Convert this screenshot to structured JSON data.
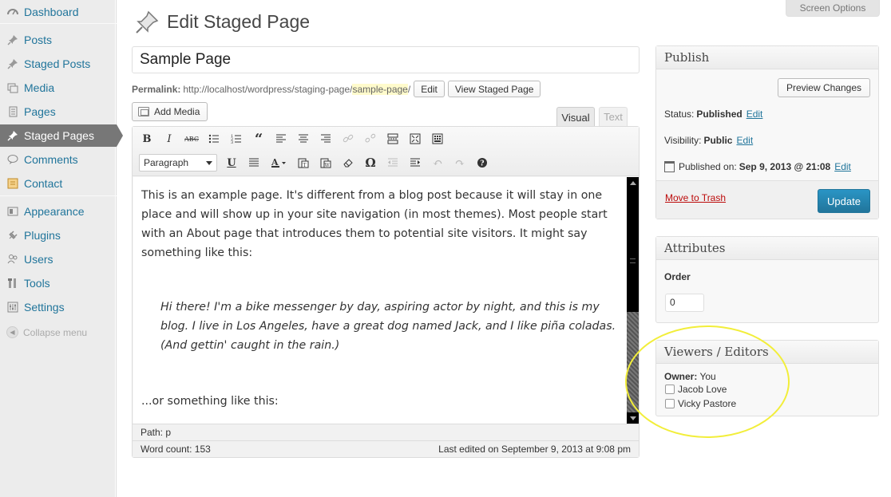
{
  "admin_menu": {
    "items": [
      {
        "label": "Dashboard",
        "icon": "dashboard-icon"
      },
      {
        "label": "Posts",
        "icon": "pin-icon"
      },
      {
        "label": "Staged Posts",
        "icon": "pin-icon"
      },
      {
        "label": "Media",
        "icon": "media-icon"
      },
      {
        "label": "Pages",
        "icon": "pages-icon"
      },
      {
        "label": "Staged Pages",
        "icon": "pin-icon",
        "current": true
      },
      {
        "label": "Comments",
        "icon": "comment-icon"
      },
      {
        "label": "Contact",
        "icon": "contact-icon"
      },
      {
        "label": "Appearance",
        "icon": "appearance-icon"
      },
      {
        "label": "Plugins",
        "icon": "plugin-icon"
      },
      {
        "label": "Users",
        "icon": "users-icon"
      },
      {
        "label": "Tools",
        "icon": "tools-icon"
      },
      {
        "label": "Settings",
        "icon": "settings-icon"
      }
    ],
    "collapse_label": "Collapse menu"
  },
  "header": {
    "title": "Edit Staged Page",
    "screen_options": "Screen Options"
  },
  "post": {
    "title": "Sample Page",
    "permalink_label": "Permalink:",
    "permalink_base": "http://localhost/wordpress/staging-page/",
    "permalink_slug": "sample-page",
    "permalink_end": "/",
    "edit_button": "Edit",
    "view_button": "View Staged Page"
  },
  "editor": {
    "add_media": "Add Media",
    "tab_visual": "Visual",
    "tab_text": "Text",
    "format_select": "Paragraph",
    "paragraph_1": "This is an example page. It's different from a blog post because it will stay in one place and will show up in your site navigation (in most themes). Most people start with an About page that introduces them to potential site visitors. It might say something like this:",
    "quote": "Hi there! I'm a bike messenger by day, aspiring actor by night, and this is my blog. I live in Los Angeles, have a great dog named Jack, and I like piña coladas. (And gettin' caught in the rain.)",
    "paragraph_2": "...or something like this:",
    "path": "Path: p",
    "word_count": "Word count: 153",
    "last_edited": "Last edited on September 9, 2013 at 9:08 pm"
  },
  "publish": {
    "title": "Publish",
    "preview_button": "Preview Changes",
    "status_label": "Status:",
    "status_value": "Published",
    "visibility_label": "Visibility:",
    "visibility_value": "Public",
    "published_label": "Published on:",
    "published_value": "Sep 9, 2013 @ 21:08",
    "edit_link": "Edit",
    "trash_link": "Move to Trash",
    "update_button": "Update"
  },
  "attributes": {
    "title": "Attributes",
    "order_label": "Order",
    "order_value": "0"
  },
  "viewers": {
    "title": "Viewers / Editors",
    "owner_label": "Owner:",
    "owner_value": "You",
    "users": [
      "Jacob Love",
      "Vicky Pastore"
    ]
  },
  "colors": {
    "link": "#21759b",
    "menu_current": "#777777",
    "update_button": "#21759b",
    "trash": "#bc0b0b",
    "highlight": "#f2ee3a"
  }
}
